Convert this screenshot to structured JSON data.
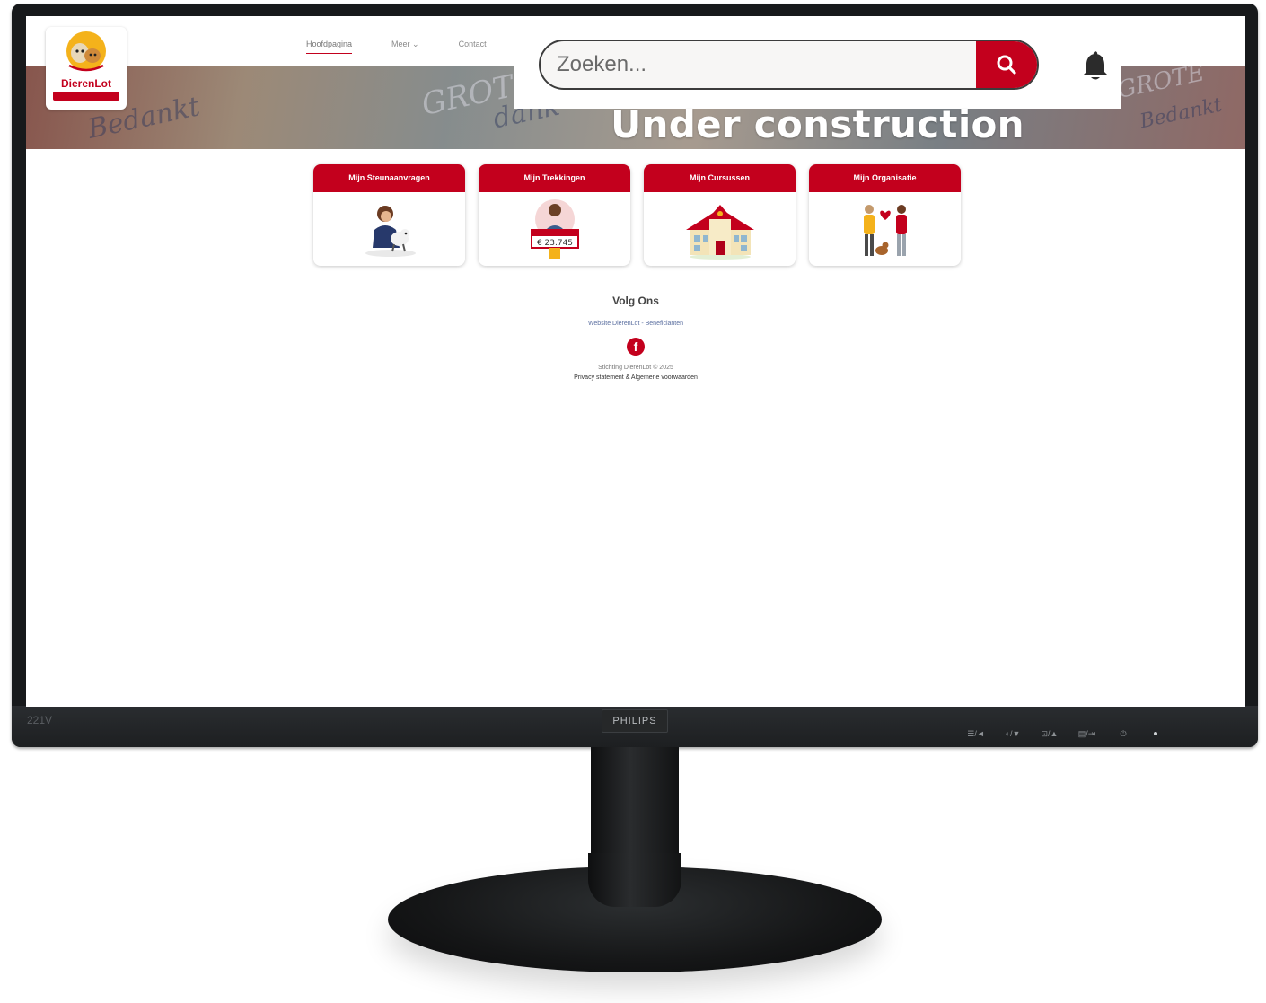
{
  "monitor": {
    "model": "221V",
    "brand": "PHILIPS",
    "controls": [
      "☰/◄",
      "◐/▼",
      "⊡/▲",
      "▤/⇥",
      "⏻"
    ]
  },
  "site": {
    "logo_name": "DierenLot",
    "nav": [
      "Hoofdpagina",
      "Meer ⌄",
      "Contact"
    ],
    "search": {
      "placeholder": "Zoeken..."
    },
    "hero_words": [
      "Bedankt",
      "GROTE",
      "dank",
      "GROTE",
      "Bedankt"
    ],
    "banner_text": "Under construction",
    "cards": [
      {
        "title": "Mijn Steunaanvragen",
        "icon": "person-with-dog-icon"
      },
      {
        "title": "Mijn Trekkingen",
        "icon": "person-holding-check-icon"
      },
      {
        "title": "Mijn Cursussen",
        "icon": "school-building-icon"
      },
      {
        "title": "Mijn Organisatie",
        "icon": "people-with-heart-icon"
      }
    ],
    "check_amount": "€ 23.745",
    "footer": {
      "follow": "Volg Ons",
      "link": "Website DierenLot - Beneficianten",
      "social_icon": "facebook-icon",
      "copyright": "Stichting DierenLot © 2025",
      "legal": "Privacy statement & Algemene voorwaarden"
    }
  },
  "colors": {
    "brand_red": "#c3001d",
    "bezel": "#17191b"
  }
}
